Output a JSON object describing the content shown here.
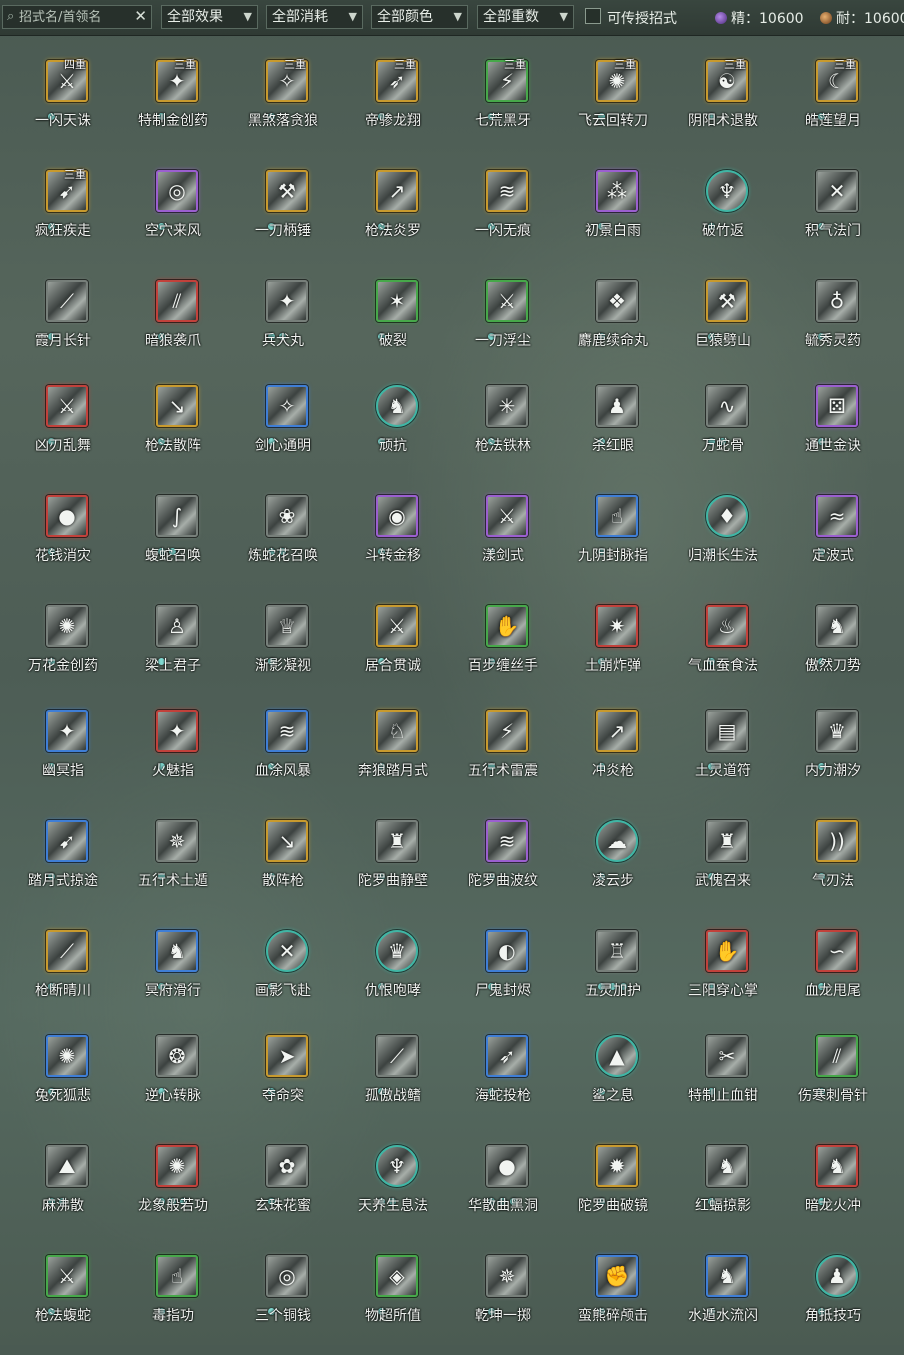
{
  "filters": {
    "search_placeholder": "招式名/首领名",
    "effect": "全部效果",
    "cost": "全部消耗",
    "color": "全部颜色",
    "tier": "全部重数",
    "transferable_label": "可传授招式",
    "jing_label": "精：10600",
    "nai_label": "耐：10600"
  },
  "colors": {
    "default": "#777f7a",
    "gold": "#c89a2e",
    "purple": "#9b5fd0",
    "blue": "#3f7ed6",
    "green": "#47a84a",
    "red": "#c2413b",
    "teal": "#3fb6a5"
  },
  "skills": [
    {
      "name": "一闪天诛",
      "tier": "四重",
      "color": "gold",
      "shape": "square",
      "dots": 1,
      "icon": "slash-icon",
      "glyph": "⚔"
    },
    {
      "name": "特制金创药",
      "tier": "三重",
      "color": "gold",
      "shape": "square",
      "dots": 1,
      "icon": "fire-icon",
      "glyph": "✦"
    },
    {
      "name": "黑煞落贪狼",
      "tier": "三重",
      "color": "gold",
      "shape": "square",
      "dots": 1,
      "icon": "dark-strike-icon",
      "glyph": "✧"
    },
    {
      "name": "帝骖龙翔",
      "tier": "三重",
      "color": "gold",
      "shape": "square",
      "dots": 1,
      "icon": "dragon-icon",
      "glyph": "➶"
    },
    {
      "name": "七荒黑牙",
      "tier": "三重",
      "color": "green",
      "shape": "square",
      "dots": 1,
      "icon": "claw-icon",
      "glyph": "⚡"
    },
    {
      "name": "飞云回转刀",
      "tier": "三重",
      "color": "gold",
      "shape": "square",
      "dots": 1,
      "icon": "blade-spin-icon",
      "glyph": "✺"
    },
    {
      "name": "阴阳术退散",
      "tier": "三重",
      "color": "gold",
      "shape": "square",
      "dots": 1,
      "icon": "yin-yang-icon",
      "glyph": "☯"
    },
    {
      "name": "皓莲望月",
      "tier": "三重",
      "color": "gold",
      "shape": "square",
      "dots": 1,
      "icon": "moon-icon",
      "glyph": "☾"
    },
    {
      "name": "疯狂疾走",
      "tier": "三重",
      "color": "gold",
      "shape": "square",
      "dots": 1,
      "icon": "dash-icon",
      "glyph": "➹"
    },
    {
      "name": "空穴来风",
      "tier": "",
      "color": "purple",
      "shape": "square",
      "dots": 1,
      "icon": "coin-icon",
      "glyph": "◎"
    },
    {
      "name": "一刀柄锤",
      "tier": "",
      "color": "gold",
      "shape": "square",
      "dots": 1,
      "icon": "hammer-icon",
      "glyph": "⚒"
    },
    {
      "name": "枪法炎罗",
      "tier": "",
      "color": "gold",
      "shape": "square",
      "dots": 1,
      "icon": "spear-icon",
      "glyph": "↗"
    },
    {
      "name": "一闪无痕",
      "tier": "",
      "color": "gold",
      "shape": "square",
      "dots": 1,
      "icon": "swift-slash-icon",
      "glyph": "≋"
    },
    {
      "name": "初景白雨",
      "tier": "",
      "color": "purple",
      "shape": "square",
      "dots": 1,
      "icon": "rain-icon",
      "glyph": "⁂"
    },
    {
      "name": "破竹返",
      "tier": "",
      "color": "teal",
      "shape": "round",
      "dots": 1,
      "icon": "bamboo-icon",
      "glyph": "♆"
    },
    {
      "name": "积气法门",
      "tier": "",
      "color": "default",
      "shape": "square",
      "dots": 1,
      "icon": "qi-icon",
      "glyph": "✕"
    },
    {
      "name": "霞月长针",
      "tier": "",
      "color": "default",
      "shape": "square",
      "dots": 1,
      "icon": "needle-icon",
      "glyph": "⟋"
    },
    {
      "name": "暗狼袭爪",
      "tier": "",
      "color": "red",
      "shape": "square",
      "dots": 1,
      "icon": "wolf-claw-icon",
      "glyph": "⫽"
    },
    {
      "name": "兵犬丸",
      "tier": "",
      "color": "default",
      "shape": "square",
      "dots": 2,
      "icon": "hound-icon",
      "glyph": "✦"
    },
    {
      "name": "破裂",
      "tier": "",
      "color": "green",
      "shape": "square",
      "dots": 1,
      "icon": "shatter-icon",
      "glyph": "✶"
    },
    {
      "name": "一刀浮尘",
      "tier": "",
      "color": "green",
      "shape": "square",
      "dots": 1,
      "icon": "dust-blade-icon",
      "glyph": "⚔"
    },
    {
      "name": "麝鹿续命丸",
      "tier": "",
      "color": "default",
      "shape": "square",
      "dots": 1,
      "icon": "pill-icon",
      "glyph": "❖"
    },
    {
      "name": "巨猿劈山",
      "tier": "",
      "color": "gold",
      "shape": "square",
      "dots": 1,
      "icon": "ape-icon",
      "glyph": "⚒"
    },
    {
      "name": "毓秀灵药",
      "tier": "",
      "color": "default",
      "shape": "square",
      "dots": 1,
      "icon": "gourd-icon",
      "glyph": "♁"
    },
    {
      "name": "凶刃乱舞",
      "tier": "",
      "color": "red",
      "shape": "square",
      "dots": 1,
      "icon": "blade-dance-icon",
      "glyph": "⚔"
    },
    {
      "name": "枪法散阵",
      "tier": "",
      "color": "gold",
      "shape": "square",
      "dots": 1,
      "icon": "spear-icon",
      "glyph": "↘"
    },
    {
      "name": "剑心通明",
      "tier": "",
      "color": "blue",
      "shape": "square",
      "dots": 1,
      "icon": "sword-icon",
      "glyph": "✧"
    },
    {
      "name": "顽抗",
      "tier": "",
      "color": "teal",
      "shape": "round",
      "dots": 1,
      "icon": "resist-icon",
      "glyph": "♞"
    },
    {
      "name": "枪法铁林",
      "tier": "",
      "color": "default",
      "shape": "square",
      "dots": 1,
      "icon": "spear-forest-icon",
      "glyph": "✳"
    },
    {
      "name": "杀红眼",
      "tier": "",
      "color": "default",
      "shape": "square",
      "dots": 1,
      "icon": "red-eye-icon",
      "glyph": "♟"
    },
    {
      "name": "万蛇骨",
      "tier": "",
      "color": "default",
      "shape": "square",
      "dots": 2,
      "icon": "snake-icon",
      "glyph": "∿"
    },
    {
      "name": "通世金诀",
      "tier": "",
      "color": "purple",
      "shape": "square",
      "dots": 1,
      "icon": "dice-icon",
      "glyph": "⚄"
    },
    {
      "name": "花钱消灾",
      "tier": "",
      "color": "red",
      "shape": "square",
      "dots": 1,
      "icon": "purse-icon",
      "glyph": "●"
    },
    {
      "name": "蝮蛇召唤",
      "tier": "",
      "color": "default",
      "shape": "square",
      "dots": 2,
      "icon": "viper-icon",
      "glyph": "∫"
    },
    {
      "name": "炼蛇花召唤",
      "tier": "",
      "color": "default",
      "shape": "square",
      "dots": 2,
      "icon": "serpent-flower-icon",
      "glyph": "❀"
    },
    {
      "name": "斗转金移",
      "tier": "",
      "color": "purple",
      "shape": "square",
      "dots": 1,
      "icon": "swirl-icon",
      "glyph": "◉"
    },
    {
      "name": "漾剑式",
      "tier": "",
      "color": "purple",
      "shape": "square",
      "dots": 1,
      "icon": "ripple-sword-icon",
      "glyph": "⚔"
    },
    {
      "name": "九阴封脉指",
      "tier": "",
      "color": "blue",
      "shape": "square",
      "dots": 1,
      "icon": "finger-icon",
      "glyph": "☝"
    },
    {
      "name": "归潮长生法",
      "tier": "",
      "color": "teal",
      "shape": "round",
      "dots": 1,
      "icon": "tide-icon",
      "glyph": "♦"
    },
    {
      "name": "定波式",
      "tier": "",
      "color": "purple",
      "shape": "square",
      "dots": 1,
      "icon": "wave-icon",
      "glyph": "≈"
    },
    {
      "name": "万花金创药",
      "tier": "",
      "color": "default",
      "shape": "square",
      "dots": 1,
      "icon": "medicine-icon",
      "glyph": "✺"
    },
    {
      "name": "梁上君子",
      "tier": "",
      "color": "default",
      "shape": "square",
      "dots": 1,
      "icon": "thief-icon",
      "glyph": "♙"
    },
    {
      "name": "渐影凝视",
      "tier": "",
      "color": "default",
      "shape": "square",
      "dots": 1,
      "icon": "gaze-icon",
      "glyph": "♕"
    },
    {
      "name": "居合贯诚",
      "tier": "",
      "color": "gold",
      "shape": "square",
      "dots": 1,
      "icon": "iai-icon",
      "glyph": "⚔"
    },
    {
      "name": "百步缠丝手",
      "tier": "",
      "color": "green",
      "shape": "square",
      "dots": 1,
      "icon": "silk-hand-icon",
      "glyph": "✋"
    },
    {
      "name": "土崩炸弹",
      "tier": "",
      "color": "red",
      "shape": "square",
      "dots": 1,
      "icon": "bomb-icon",
      "glyph": "✷"
    },
    {
      "name": "气血蚕食法",
      "tier": "",
      "color": "red",
      "shape": "square",
      "dots": 1,
      "icon": "drain-icon",
      "glyph": "♨"
    },
    {
      "name": "傲然刀势",
      "tier": "",
      "color": "default",
      "shape": "square",
      "dots": 1,
      "icon": "proud-blade-icon",
      "glyph": "♞"
    },
    {
      "name": "幽冥指",
      "tier": "",
      "color": "blue",
      "shape": "square",
      "dots": 1,
      "icon": "nether-finger-icon",
      "glyph": "✦"
    },
    {
      "name": "火魅指",
      "tier": "",
      "color": "red",
      "shape": "square",
      "dots": 1,
      "icon": "fire-finger-icon",
      "glyph": "✦"
    },
    {
      "name": "血涂风暴",
      "tier": "",
      "color": "blue",
      "shape": "square",
      "dots": 1,
      "icon": "storm-icon",
      "glyph": "≋"
    },
    {
      "name": "奔狼踏月式",
      "tier": "",
      "color": "gold",
      "shape": "square",
      "dots": 1,
      "icon": "wolf-icon",
      "glyph": "♘"
    },
    {
      "name": "五行术雷震",
      "tier": "",
      "color": "gold",
      "shape": "square",
      "dots": 1,
      "icon": "thunder-icon",
      "glyph": "⚡"
    },
    {
      "name": "冲炎枪",
      "tier": "",
      "color": "gold",
      "shape": "square",
      "dots": 1,
      "icon": "flame-spear-icon",
      "glyph": "↗"
    },
    {
      "name": "土灵道符",
      "tier": "",
      "color": "default",
      "shape": "square",
      "dots": 1,
      "icon": "talisman-icon",
      "glyph": "▤"
    },
    {
      "name": "内力潮汐",
      "tier": "",
      "color": "default",
      "shape": "square",
      "dots": 1,
      "icon": "inner-tide-icon",
      "glyph": "♛"
    },
    {
      "name": "踏月式掠途",
      "tier": "",
      "color": "blue",
      "shape": "square",
      "dots": 1,
      "icon": "moon-step-icon",
      "glyph": "➹"
    },
    {
      "name": "五行术土遁",
      "tier": "",
      "color": "default",
      "shape": "square",
      "dots": 1,
      "icon": "earth-escape-icon",
      "glyph": "✵"
    },
    {
      "name": "散阵枪",
      "tier": "",
      "color": "gold",
      "shape": "square",
      "dots": 1,
      "icon": "spear-icon",
      "glyph": "↘"
    },
    {
      "name": "陀罗曲静壁",
      "tier": "",
      "color": "default",
      "shape": "square",
      "dots": 1,
      "icon": "wall-icon",
      "glyph": "♜"
    },
    {
      "name": "陀罗曲波纹",
      "tier": "",
      "color": "purple",
      "shape": "square",
      "dots": 1,
      "icon": "ripple-icon",
      "glyph": "≋"
    },
    {
      "name": "凌云步",
      "tier": "",
      "color": "teal",
      "shape": "round",
      "dots": 1,
      "icon": "cloud-step-icon",
      "glyph": "☁"
    },
    {
      "name": "武傀召来",
      "tier": "",
      "color": "default",
      "shape": "square",
      "dots": 1,
      "icon": "puppet-icon",
      "glyph": "♜"
    },
    {
      "name": "气刃法",
      "tier": "",
      "color": "gold",
      "shape": "square",
      "dots": 1,
      "icon": "qi-blade-icon",
      "glyph": "))"
    },
    {
      "name": "枪断晴川",
      "tier": "",
      "color": "gold",
      "shape": "square",
      "dots": 1,
      "icon": "spear-break-icon",
      "glyph": "⟋"
    },
    {
      "name": "冥府滑行",
      "tier": "",
      "color": "blue",
      "shape": "square",
      "dots": 1,
      "icon": "glide-icon",
      "glyph": "♞"
    },
    {
      "name": "画影飞赴",
      "tier": "",
      "color": "teal",
      "shape": "round",
      "dots": 1,
      "icon": "flying-shadow-icon",
      "glyph": "✕"
    },
    {
      "name": "仇恨咆哮",
      "tier": "",
      "color": "teal",
      "shape": "round",
      "dots": 1,
      "icon": "roar-icon",
      "glyph": "♛"
    },
    {
      "name": "尸鬼封烬",
      "tier": "",
      "color": "blue",
      "shape": "square",
      "dots": 1,
      "icon": "ghost-seal-icon",
      "glyph": "◐"
    },
    {
      "name": "五灵加护",
      "tier": "",
      "color": "default",
      "shape": "square",
      "dots": 3,
      "icon": "blessing-icon",
      "glyph": "♖"
    },
    {
      "name": "三阳穿心掌",
      "tier": "",
      "color": "red",
      "shape": "square",
      "dots": 1,
      "icon": "palm-icon",
      "glyph": "✋"
    },
    {
      "name": "血龙甩尾",
      "tier": "",
      "color": "red",
      "shape": "square",
      "dots": 1,
      "icon": "dragon-tail-icon",
      "glyph": "∽"
    },
    {
      "name": "兔死狐悲",
      "tier": "",
      "color": "blue",
      "shape": "square",
      "dots": 1,
      "icon": "fox-icon",
      "glyph": "✺"
    },
    {
      "name": "逆心转脉",
      "tier": "",
      "color": "default",
      "shape": "square",
      "dots": 1,
      "icon": "meridian-icon",
      "glyph": "❂"
    },
    {
      "name": "夺命突",
      "tier": "",
      "color": "gold",
      "shape": "square",
      "dots": 1,
      "icon": "thrust-icon",
      "glyph": "➤"
    },
    {
      "name": "孤傲战鳍",
      "tier": "",
      "color": "default",
      "shape": "square",
      "dots": 1,
      "icon": "fin-icon",
      "glyph": "⟋"
    },
    {
      "name": "海蛇投枪",
      "tier": "",
      "color": "blue",
      "shape": "square",
      "dots": 1,
      "icon": "javelin-icon",
      "glyph": "➶"
    },
    {
      "name": "鲨之息",
      "tier": "",
      "color": "teal",
      "shape": "round",
      "dots": 1,
      "icon": "shark-icon",
      "glyph": "▲"
    },
    {
      "name": "特制止血钳",
      "tier": "",
      "color": "default",
      "shape": "square",
      "dots": 1,
      "icon": "clamp-icon",
      "glyph": "✂"
    },
    {
      "name": "伤寒刺骨针",
      "tier": "",
      "color": "green",
      "shape": "square",
      "dots": 1,
      "icon": "cold-needle-icon",
      "glyph": "⫽"
    },
    {
      "name": "麻沸散",
      "tier": "",
      "color": "default",
      "shape": "square",
      "dots": 2,
      "icon": "anesthetic-icon",
      "glyph": "⛰"
    },
    {
      "name": "龙象般若功",
      "tier": "",
      "color": "red",
      "shape": "square",
      "dots": 3,
      "icon": "prajna-icon",
      "glyph": "✺"
    },
    {
      "name": "玄珠花蜜",
      "tier": "",
      "color": "default",
      "shape": "square",
      "dots": 1,
      "icon": "nectar-icon",
      "glyph": "✿"
    },
    {
      "name": "天养生息法",
      "tier": "",
      "color": "teal",
      "shape": "round",
      "dots": 2,
      "icon": "regen-icon",
      "glyph": "♆"
    },
    {
      "name": "华散曲黑洞",
      "tier": "",
      "color": "default",
      "shape": "square",
      "dots": 3,
      "icon": "black-hole-icon",
      "glyph": "●"
    },
    {
      "name": "陀罗曲破镜",
      "tier": "",
      "color": "gold",
      "shape": "square",
      "dots": 1,
      "icon": "mirror-icon",
      "glyph": "✹"
    },
    {
      "name": "红蝠掠影",
      "tier": "",
      "color": "default",
      "shape": "square",
      "dots": 1,
      "icon": "bat-icon",
      "glyph": "♞"
    },
    {
      "name": "暗龙火冲",
      "tier": "",
      "color": "red",
      "shape": "square",
      "dots": 1,
      "icon": "dark-dragon-icon",
      "glyph": "♞"
    },
    {
      "name": "枪法蝮蛇",
      "tier": "",
      "color": "green",
      "shape": "square",
      "dots": 1,
      "icon": "viper-spear-icon",
      "glyph": "⚔"
    },
    {
      "name": "毒指功",
      "tier": "",
      "color": "green",
      "shape": "square",
      "dots": 1,
      "icon": "poison-finger-icon",
      "glyph": "☝"
    },
    {
      "name": "三个铜钱",
      "tier": "",
      "color": "default",
      "shape": "square",
      "dots": 1,
      "icon": "coins-icon",
      "glyph": "◎"
    },
    {
      "name": "物超所值",
      "tier": "",
      "color": "green",
      "shape": "square",
      "dots": 1,
      "icon": "bargain-icon",
      "glyph": "◈"
    },
    {
      "name": "乾坤一掷",
      "tier": "",
      "color": "default",
      "shape": "square",
      "dots": 1,
      "icon": "throw-icon",
      "glyph": "✵"
    },
    {
      "name": "蛮熊碎颅击",
      "tier": "",
      "color": "blue",
      "shape": "square",
      "dots": 1,
      "icon": "bear-icon",
      "glyph": "✊"
    },
    {
      "name": "水遁水流闪",
      "tier": "",
      "color": "blue",
      "shape": "square",
      "dots": 1,
      "icon": "water-escape-icon",
      "glyph": "♞"
    },
    {
      "name": "角抵技巧",
      "tier": "",
      "color": "teal",
      "shape": "round",
      "dots": 1,
      "icon": "wrestle-icon",
      "glyph": "♟"
    }
  ]
}
